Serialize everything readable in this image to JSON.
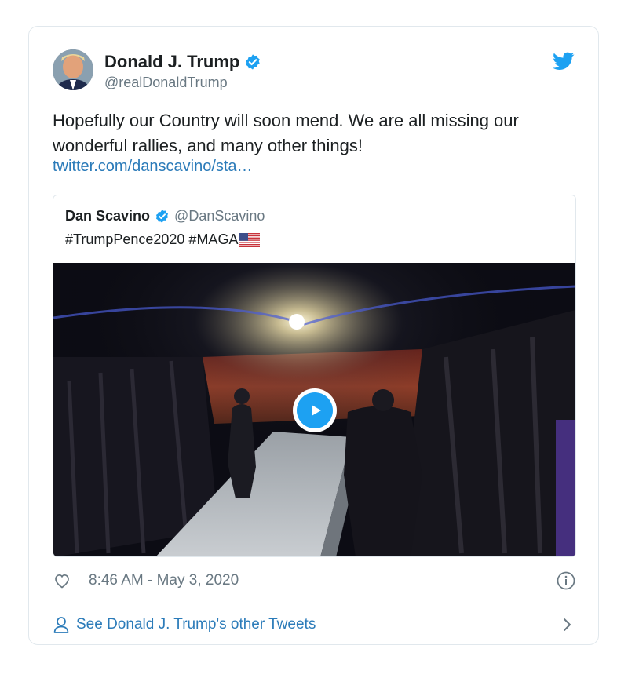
{
  "tweet": {
    "author_name": "Donald J. Trump",
    "author_handle": "@realDonaldTrump",
    "text": "Hopefully our Country will soon mend. We are all missing our wonderful rallies, and many other things!",
    "link_text": "twitter.com/danscavino/sta…",
    "timestamp": "8:46 AM - May 3, 2020",
    "other_tweets_label": "See Donald J. Trump's other Tweets"
  },
  "quoted_tweet": {
    "author_name": "Dan Scavino",
    "author_handle": "@DanScavino",
    "text": "#TrumpPence2020 #MAGA",
    "emoji": "us-flag"
  },
  "icons": {
    "verified": "verified-badge-icon",
    "bird": "twitter-bird-icon",
    "play": "play-icon",
    "heart": "heart-icon",
    "info": "info-icon",
    "person": "person-icon",
    "chevron": "chevron-right-icon"
  },
  "colors": {
    "link": "#2b7bb9",
    "twitter_blue": "#1da1f2",
    "muted": "#697882",
    "border": "#e1e8ed"
  }
}
